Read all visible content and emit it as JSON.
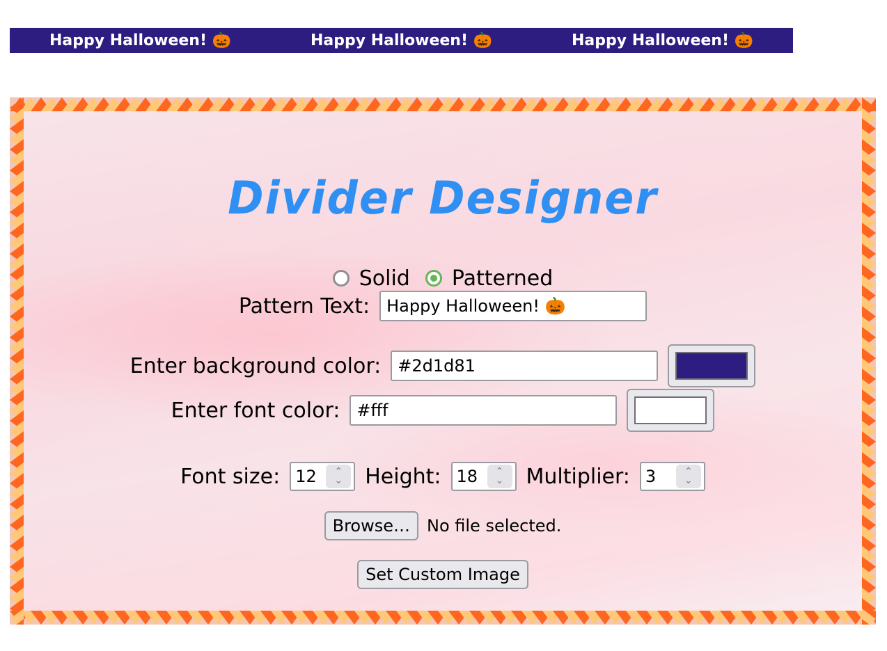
{
  "divider": {
    "items": [
      "Happy Halloween! 🎃",
      "Happy Halloween! 🎃",
      "Happy Halloween! 🎃"
    ],
    "background_color": "#2d1d81",
    "font_color": "#ffffff"
  },
  "designer": {
    "title": "Divider Designer",
    "title_color": "#2f8ff2",
    "border_colors": [
      "#ff6620",
      "#ffc878"
    ],
    "pattern_type": {
      "options": [
        {
          "label": "Solid",
          "checked": false
        },
        {
          "label": "Patterned",
          "checked": true
        }
      ]
    },
    "pattern_text": {
      "label": "Pattern Text:",
      "value": "Happy Halloween! 🎃"
    },
    "background_color": {
      "label": "Enter background color:",
      "value": "#2d1d81",
      "swatch": "#2d1d81"
    },
    "font_color": {
      "label": "Enter font color:",
      "value": "#fff",
      "swatch": "#ffffff"
    },
    "font_size": {
      "label": "Font size:",
      "value": "12"
    },
    "height": {
      "label": "Height:",
      "value": "18"
    },
    "multiplier": {
      "label": "Multiplier:",
      "value": "3"
    },
    "file": {
      "button_label": "Browse…",
      "status": "No file selected."
    },
    "set_image_button": "Set Custom Image"
  },
  "icons": {
    "spinner_up": "chevron-up-icon",
    "spinner_down": "chevron-down-icon",
    "pumpkin": "jack-o-lantern-icon"
  }
}
